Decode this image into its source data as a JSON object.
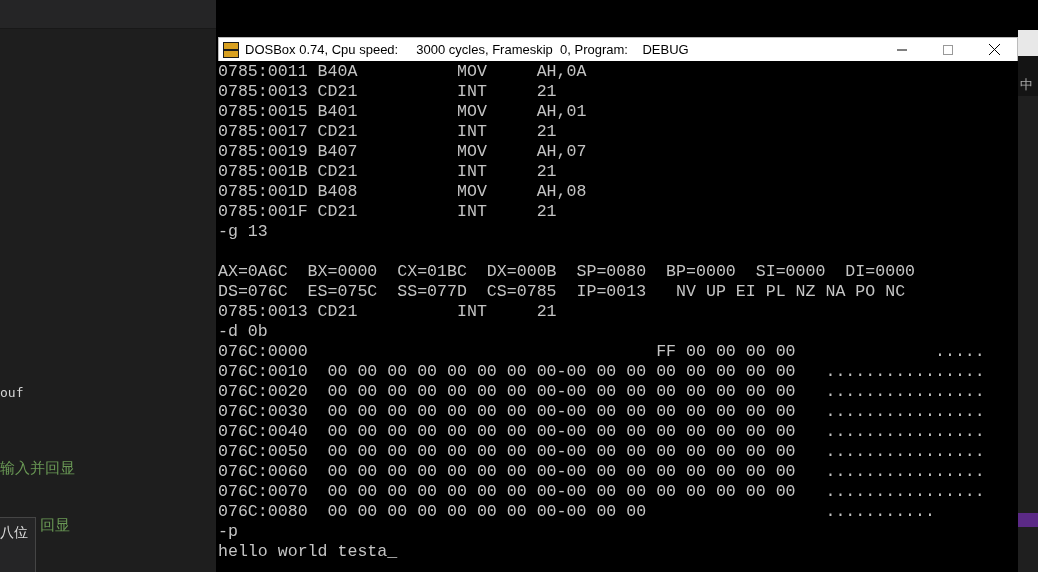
{
  "editor": {
    "lines": [
      {
        "text": "ouf",
        "kind": "code"
      },
      {
        "text": "输入并回显",
        "kind": "comment"
      },
      {
        "text": "回显",
        "kind": "comment"
      }
    ],
    "tooltip": "八位"
  },
  "side_strip": {
    "label": "中"
  },
  "window": {
    "title": "DOSBox 0.74, Cpu speed:     3000 cycles, Frameskip  0, Program:    DEBUG",
    "console": {
      "blocks": [
        [
          "0785:0011 B40A          MOV     AH,0A",
          "0785:0013 CD21          INT     21",
          "0785:0015 B401          MOV     AH,01",
          "0785:0017 CD21          INT     21",
          "0785:0019 B407          MOV     AH,07",
          "0785:001B CD21          INT     21",
          "0785:001D B408          MOV     AH,08",
          "0785:001F CD21          INT     21",
          "-g 13"
        ],
        [
          "AX=0A6C  BX=0000  CX=01BC  DX=000B  SP=0080  BP=0000  SI=0000  DI=0000",
          "DS=076C  ES=075C  SS=077D  CS=0785  IP=0013   NV UP EI PL NZ NA PO NC",
          "0785:0013 CD21          INT     21",
          "-d 0b",
          "076C:0000                                   FF 00 00 00 00              .....",
          "076C:0010  00 00 00 00 00 00 00 00-00 00 00 00 00 00 00 00   ................",
          "076C:0020  00 00 00 00 00 00 00 00-00 00 00 00 00 00 00 00   ................",
          "076C:0030  00 00 00 00 00 00 00 00-00 00 00 00 00 00 00 00   ................",
          "076C:0040  00 00 00 00 00 00 00 00-00 00 00 00 00 00 00 00   ................",
          "076C:0050  00 00 00 00 00 00 00 00-00 00 00 00 00 00 00 00   ................",
          "076C:0060  00 00 00 00 00 00 00 00-00 00 00 00 00 00 00 00   ................",
          "076C:0070  00 00 00 00 00 00 00 00-00 00 00 00 00 00 00 00   ................",
          "076C:0080  00 00 00 00 00 00 00 00-00 00 00                  ...........",
          "-p",
          "hello world testa_"
        ]
      ]
    }
  }
}
